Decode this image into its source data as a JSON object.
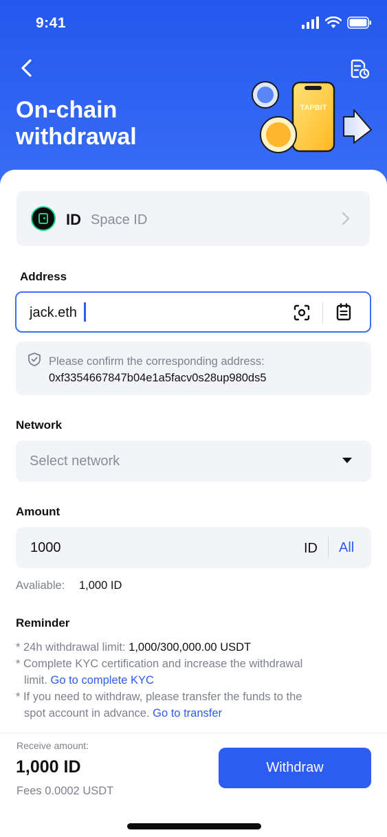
{
  "status_bar": {
    "time": "9:41"
  },
  "header": {
    "title": "On-chain withdrawal",
    "illustration_text": "TAPBIT"
  },
  "token": {
    "symbol": "ID",
    "name": "Space ID"
  },
  "address": {
    "label": "Address",
    "value": "jack.eth",
    "confirm_text": "Please confirm the corresponding address:",
    "resolved_address": "0xf3354667847b04e1a5facv0s28up980ds5"
  },
  "network": {
    "label": "Network",
    "placeholder": "Select network"
  },
  "amount": {
    "label": "Amount",
    "value": "1000",
    "unit": "ID",
    "all_label": "All",
    "available_label": "Avaliable:",
    "available_value": "1,000 ID"
  },
  "reminder": {
    "title": "Reminder",
    "limit_prefix": "* 24h withdrawal limit: ",
    "limit_value": "1,000/300,000.00 USDT",
    "kyc_line1": "* Complete KYC certification and increase the withdrawal",
    "kyc_line2": "limit. ",
    "kyc_link": "Go to complete KYC",
    "transfer_line1": "* If you need to withdraw, please transfer the funds to the",
    "transfer_line2": "spot account in advance. ",
    "transfer_link": "Go to transfer"
  },
  "footer": {
    "receive_label": "Receive amount:",
    "receive_value": "1,000 ID",
    "fees": "Fees 0.0002 USDT",
    "withdraw_label": "Withdraw"
  },
  "colors": {
    "primary": "#2c5cf0",
    "header_bg": "#2457ee",
    "muted_text": "#7d818b",
    "card_bg": "#f3f4f7"
  },
  "icons": [
    "back-icon",
    "history-icon",
    "chevron-right-icon",
    "scan-icon",
    "paste-icon",
    "shield-icon",
    "dropdown-icon"
  ]
}
